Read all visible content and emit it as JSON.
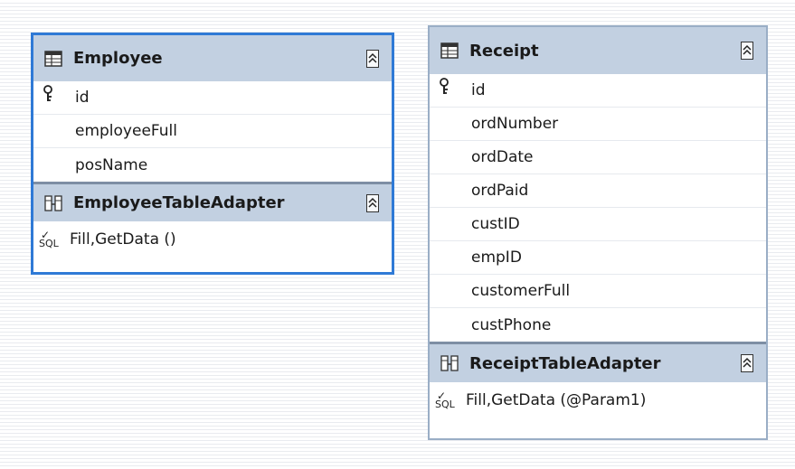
{
  "tables": [
    {
      "name": "Employee",
      "fields": [
        {
          "label": "id",
          "primary_key": true
        },
        {
          "label": "employeeFull",
          "primary_key": false
        },
        {
          "label": "posName",
          "primary_key": false
        }
      ],
      "adapter": {
        "name": "EmployeeTableAdapter",
        "methods": [
          "Fill,GetData ()"
        ]
      },
      "icon": "table-icon",
      "adapter_icon": "table-adapter-icon",
      "method_icon": "sql-query-icon",
      "key_icon": "primary-key-icon",
      "collapse_icon": "collapse-chevrons-icon",
      "selected": true
    },
    {
      "name": "Receipt",
      "fields": [
        {
          "label": "id",
          "primary_key": true
        },
        {
          "label": "ordNumber",
          "primary_key": false
        },
        {
          "label": "ordDate",
          "primary_key": false
        },
        {
          "label": "ordPaid",
          "primary_key": false
        },
        {
          "label": "custID",
          "primary_key": false
        },
        {
          "label": "empID",
          "primary_key": false
        },
        {
          "label": "customerFull",
          "primary_key": false
        },
        {
          "label": "custPhone",
          "primary_key": false
        }
      ],
      "adapter": {
        "name": "ReceiptTableAdapter",
        "methods": [
          "Fill,GetData (@Param1)"
        ]
      },
      "icon": "table-icon",
      "adapter_icon": "table-adapter-icon",
      "method_icon": "sql-query-icon",
      "key_icon": "primary-key-icon",
      "collapse_icon": "collapse-chevrons-icon",
      "selected": false
    }
  ],
  "colors": {
    "selection_border": "#2f7ad6",
    "normal_border": "#9aaec6",
    "header_bg": "#c2d0e1",
    "adapter_separator": "#7e8ea4"
  }
}
